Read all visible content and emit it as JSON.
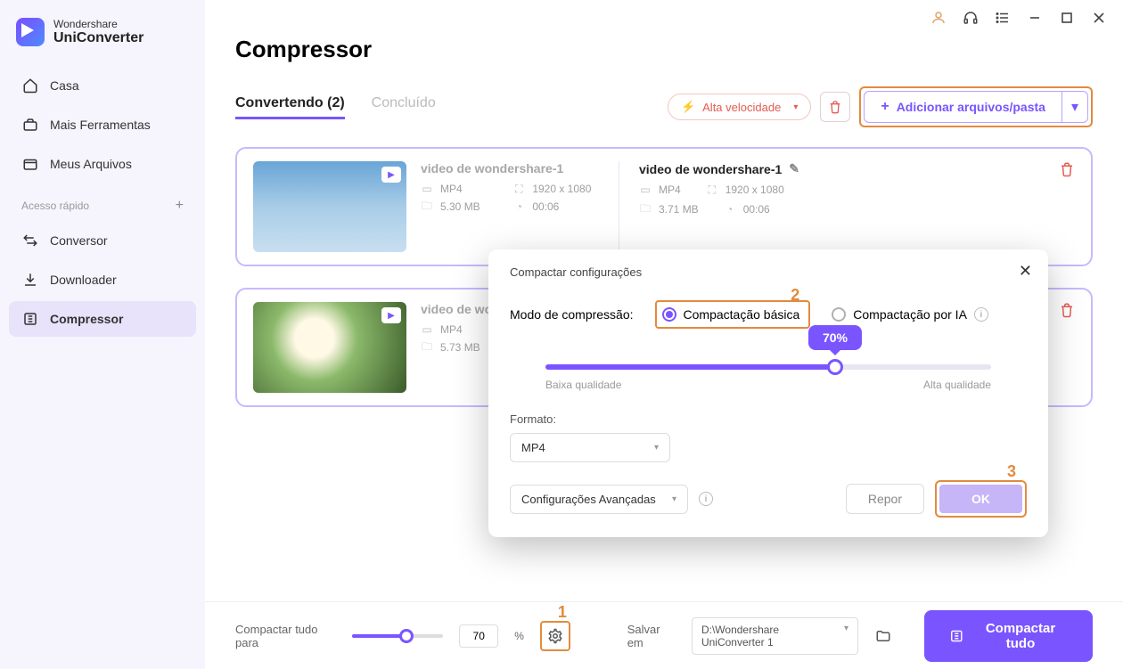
{
  "brand": {
    "line1": "Wondershare",
    "line2": "UniConverter"
  },
  "sidebar": {
    "items": [
      {
        "label": "Casa"
      },
      {
        "label": "Mais Ferramentas"
      },
      {
        "label": "Meus Arquivos"
      }
    ],
    "quick_label": "Acesso rápido",
    "quick_items": [
      {
        "label": "Conversor"
      },
      {
        "label": "Downloader"
      },
      {
        "label": "Compressor"
      }
    ]
  },
  "page": {
    "title": "Compressor"
  },
  "tabs": {
    "converting": "Convertendo (2)",
    "done": "Concluído"
  },
  "actions": {
    "speed": "Alta velocidade",
    "add": "Adicionar arquivos/pasta"
  },
  "files": [
    {
      "src_title": "video de wondershare-1",
      "src_format": "MP4",
      "src_res": "1920 x 1080",
      "src_size": "5.30 MB",
      "src_dur": "00:06",
      "dst_title": "video de wondershare-1",
      "dst_format": "MP4",
      "dst_res": "1920 x 1080",
      "dst_size": "3.71 MB",
      "dst_dur": "00:06"
    },
    {
      "src_title": "video de wom",
      "src_format": "MP4",
      "src_size": "5.73 MB"
    }
  ],
  "popup": {
    "title": "Compactar configurações",
    "mode_label": "Modo de compressão:",
    "opt_basic": "Compactação básica",
    "opt_ai": "Compactação por IA",
    "percent": "70%",
    "low_q": "Baixa qualidade",
    "high_q": "Alta qualidade",
    "format_label": "Formato:",
    "format_value": "MP4",
    "advanced": "Configurações Avançadas",
    "reset": "Repor",
    "ok": "OK"
  },
  "bottombar": {
    "compress_label": "Compactar tudo para",
    "value": "70",
    "pct": "%",
    "save_label": "Salvar em",
    "path": "D:\\Wondershare UniConverter 1",
    "main_btn": "Compactar tudo"
  },
  "callouts": {
    "n1": "1",
    "n2": "2",
    "n3": "3"
  }
}
